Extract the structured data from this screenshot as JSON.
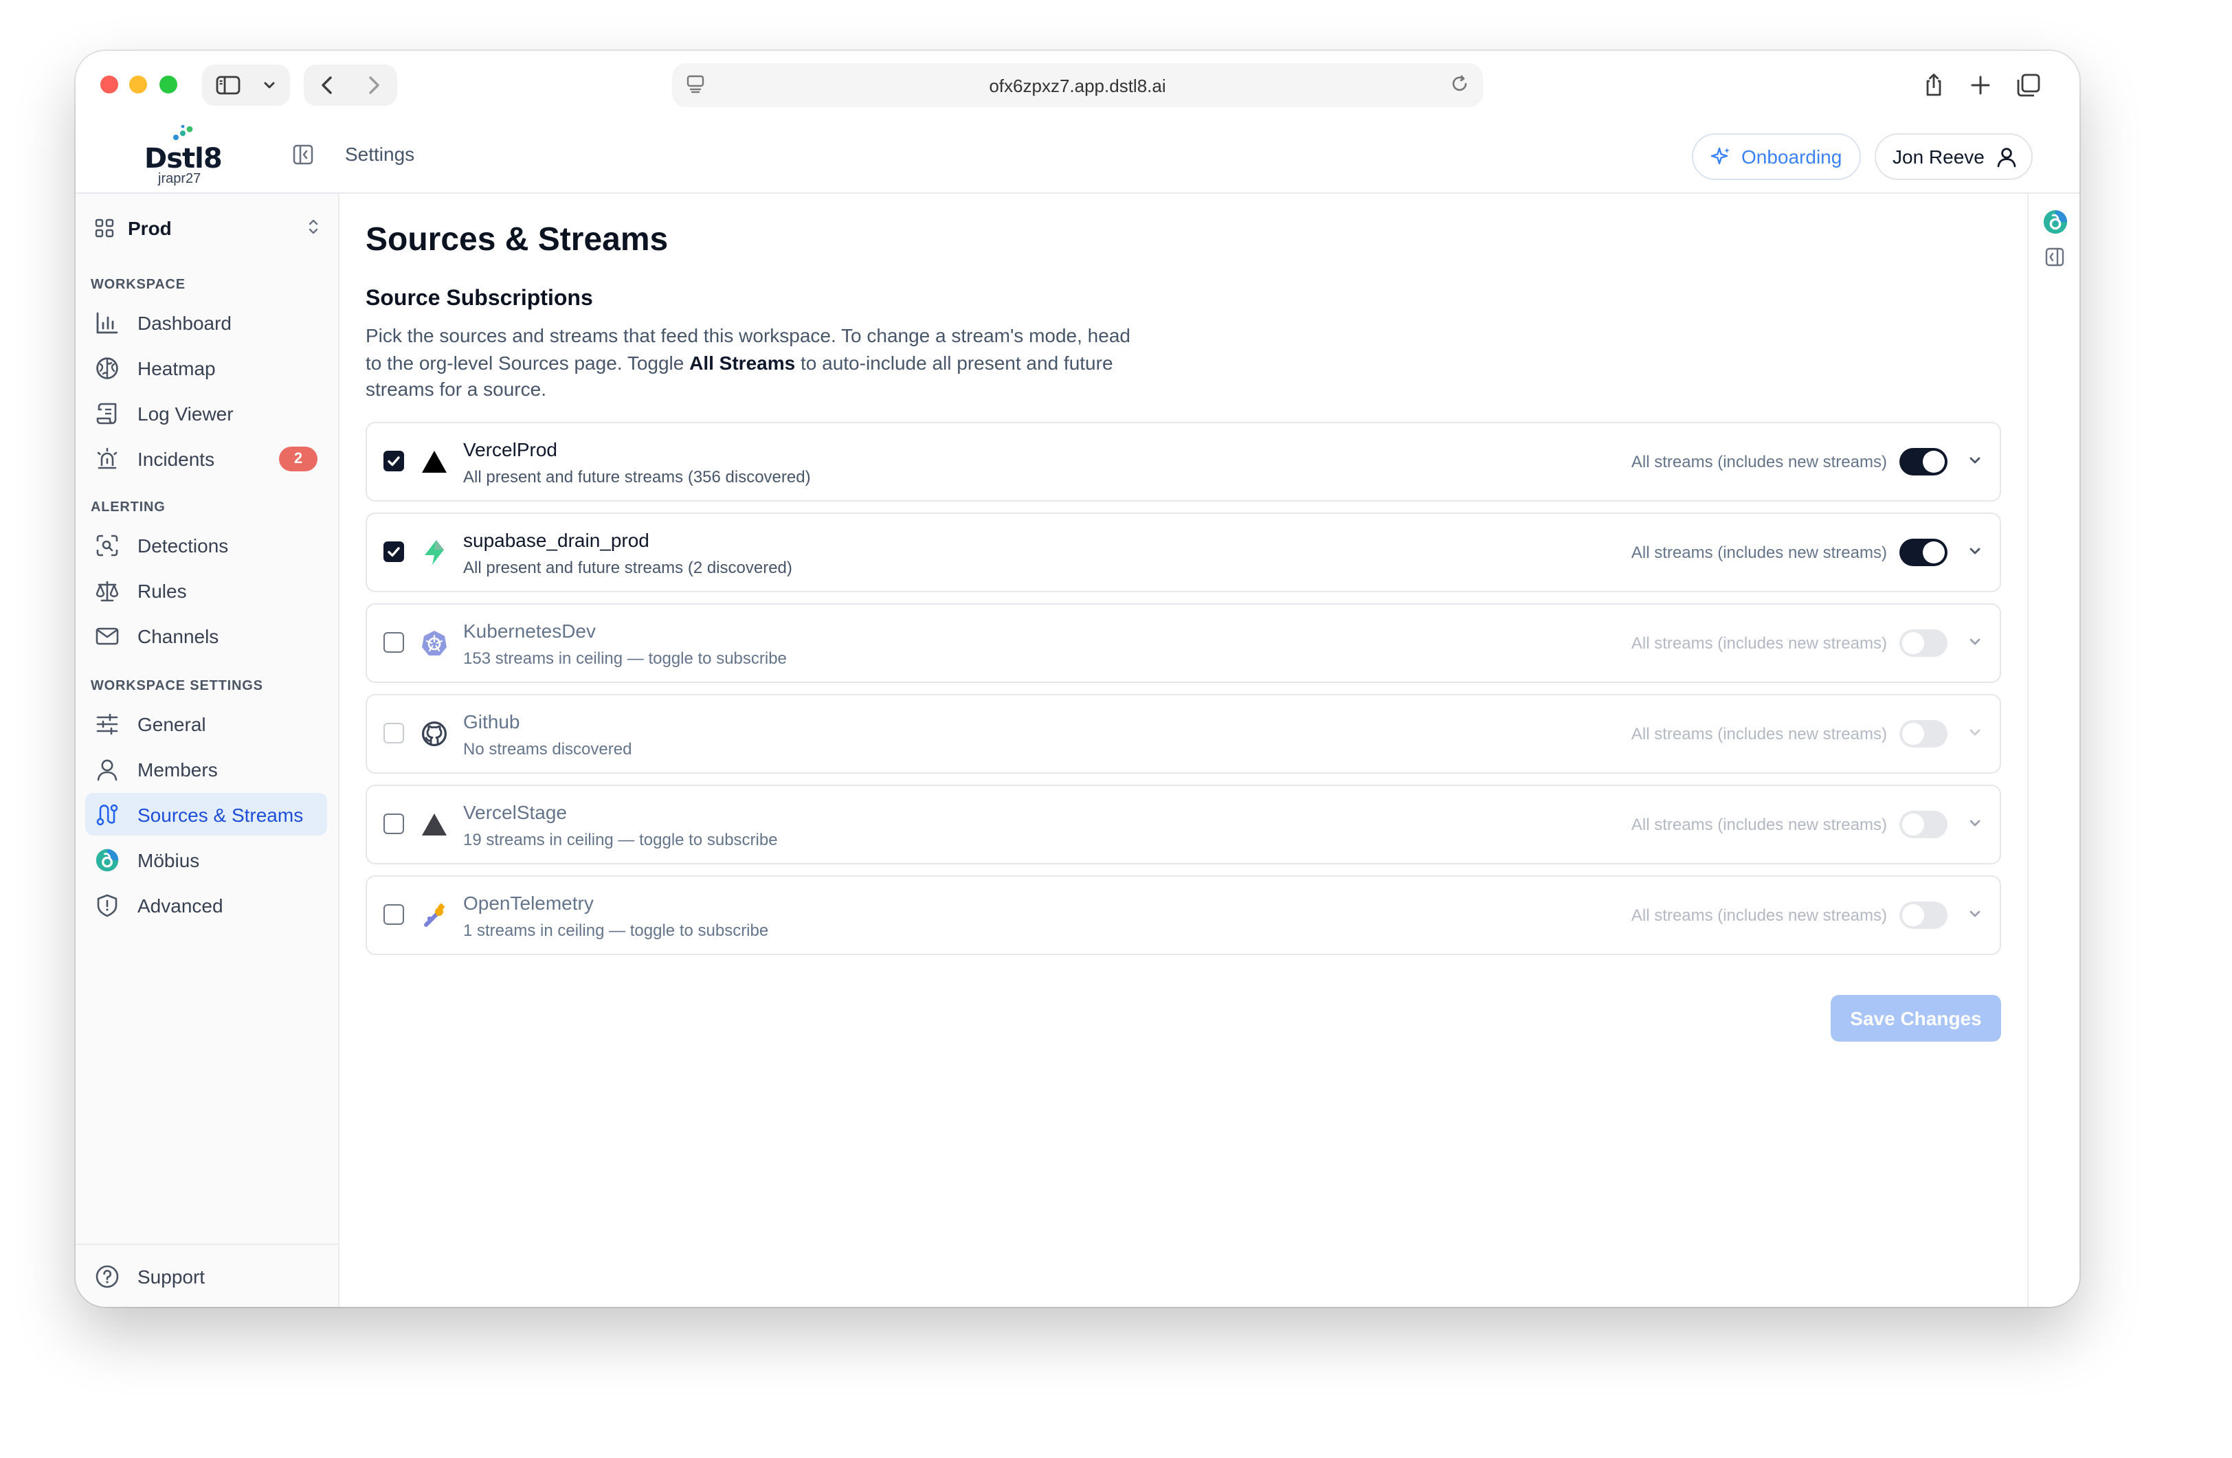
{
  "browser": {
    "url": "ofx6zpxz7.app.dstl8.ai"
  },
  "app": {
    "logo_text": "Dstl8",
    "org_slug": "jrapr27",
    "breadcrumb": "Settings",
    "onboarding_label": "Onboarding",
    "user_name": "Jon Reeve"
  },
  "sidebar": {
    "workspace": "Prod",
    "sections": [
      {
        "label": "WORKSPACE"
      },
      {
        "label": "ALERTING"
      },
      {
        "label": "WORKSPACE SETTINGS"
      }
    ],
    "items": [
      {
        "label": "Dashboard",
        "icon": "bar-chart-icon"
      },
      {
        "label": "Heatmap",
        "icon": "brain-icon"
      },
      {
        "label": "Log Viewer",
        "icon": "scroll-icon"
      },
      {
        "label": "Incidents",
        "icon": "siren-icon",
        "badge": "2"
      },
      {
        "label": "Detections",
        "icon": "scan-search-icon"
      },
      {
        "label": "Rules",
        "icon": "scale-icon"
      },
      {
        "label": "Channels",
        "icon": "mail-icon"
      },
      {
        "label": "General",
        "icon": "sliders-icon"
      },
      {
        "label": "Members",
        "icon": "user-icon"
      },
      {
        "label": "Sources & Streams",
        "icon": "route-icon",
        "active": true
      },
      {
        "label": "Möbius",
        "icon": "mobius-icon"
      },
      {
        "label": "Advanced",
        "icon": "shield-icon"
      }
    ],
    "support_label": "Support"
  },
  "main": {
    "title": "Sources & Streams",
    "section_title": "Source Subscriptions",
    "description_1": "Pick the sources and streams that feed this workspace. To change a stream's mode, head to the org-level Sources page. Toggle ",
    "description_bold": "All Streams",
    "description_2": " to auto-include all present and future streams for a source.",
    "sources": [
      {
        "name": "VercelProd",
        "sub": "All present and future streams (356 discovered)",
        "mode": "All streams (includes new streams)",
        "checked": true,
        "toggle": true,
        "icon": "vercel-triangle-icon"
      },
      {
        "name": "supabase_drain_prod",
        "sub": "All present and future streams (2 discovered)",
        "mode": "All streams (includes new streams)",
        "checked": true,
        "toggle": true,
        "icon": "supabase-bolt-icon"
      },
      {
        "name": "KubernetesDev",
        "sub": "153 streams in ceiling — toggle to subscribe",
        "mode": "All streams (includes new streams)",
        "checked": false,
        "toggle": false,
        "icon": "kubernetes-icon"
      },
      {
        "name": "Github",
        "sub": "No streams discovered",
        "mode": "All streams (includes new streams)",
        "checked": false,
        "toggle": false,
        "icon": "github-icon"
      },
      {
        "name": "VercelStage",
        "sub": "19 streams in ceiling — toggle to subscribe",
        "mode": "All streams (includes new streams)",
        "checked": false,
        "toggle": false,
        "icon": "vercel-triangle-icon"
      },
      {
        "name": "OpenTelemetry",
        "sub": "1 streams in ceiling — toggle to subscribe",
        "mode": "All streams (includes new streams)",
        "checked": false,
        "toggle": false,
        "icon": "opentelemetry-icon"
      }
    ],
    "save_label": "Save Changes"
  },
  "colors": {
    "accent": "#3b82f6",
    "active_nav_bg": "#e4edfa",
    "badge": "#ea6b61",
    "save_disabled": "#a9c4f7"
  }
}
